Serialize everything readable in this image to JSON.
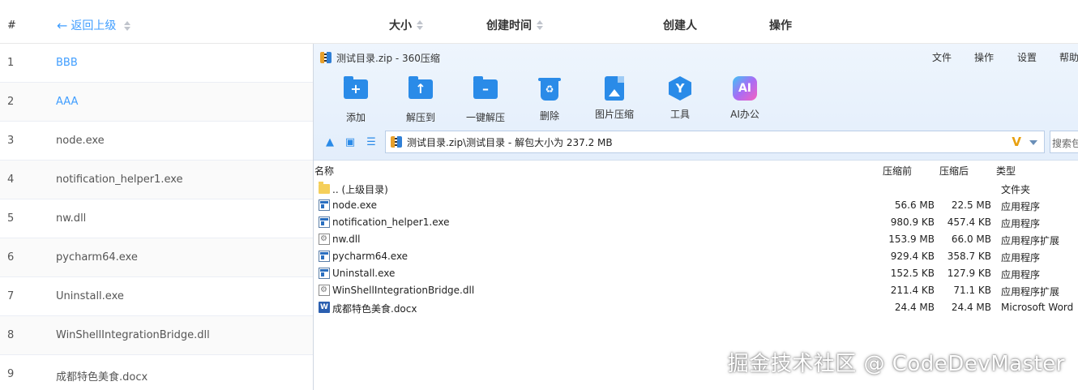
{
  "table_header": {
    "num": "#",
    "back": "返回上级",
    "size": "大小",
    "created": "创建时间",
    "creator": "创建人",
    "action": "操作"
  },
  "table_rows": [
    {
      "idx": "1",
      "name": "BBB"
    },
    {
      "idx": "2",
      "name": "AAA"
    },
    {
      "idx": "3",
      "name": "node.exe"
    },
    {
      "idx": "4",
      "name": "notification_helper1.exe"
    },
    {
      "idx": "5",
      "name": "nw.dll"
    },
    {
      "idx": "6",
      "name": "pycharm64.exe"
    },
    {
      "idx": "7",
      "name": "Uninstall.exe"
    },
    {
      "idx": "8",
      "name": "WinShellIntegrationBridge.dll"
    },
    {
      "idx": "9",
      "name": "成都特色美食.docx"
    }
  ],
  "zip_window": {
    "title": "测试目录.zip - 360压缩",
    "menu": [
      "文件",
      "操作",
      "设置",
      "帮助"
    ],
    "toolbar": [
      {
        "label": "添加",
        "icon": "add-folder-icon"
      },
      {
        "label": "解压到",
        "icon": "extract-to-icon"
      },
      {
        "label": "一键解压",
        "icon": "one-click-extract-icon"
      },
      {
        "label": "删除",
        "icon": "delete-icon"
      },
      {
        "label": "图片压缩",
        "icon": "image-compress-icon"
      },
      {
        "label": "工具",
        "icon": "tools-icon"
      },
      {
        "label": "AI办公",
        "icon": "ai-office-icon"
      }
    ],
    "ai_icon_text": "AI",
    "address": "测试目录.zip\\测试目录 - 解包大小为 237.2 MB",
    "search_placeholder": "搜索包",
    "columns": {
      "name": "名称",
      "before": "压缩前",
      "after": "压缩后",
      "type": "类型"
    },
    "files": [
      {
        "name": ".. (上级目录)",
        "before": "",
        "after": "",
        "type": "文件夹",
        "icon": "folder"
      },
      {
        "name": "node.exe",
        "before": "56.6 MB",
        "after": "22.5 MB",
        "type": "应用程序",
        "icon": "exe"
      },
      {
        "name": "notification_helper1.exe",
        "before": "980.9 KB",
        "after": "457.4 KB",
        "type": "应用程序",
        "icon": "exe"
      },
      {
        "name": "nw.dll",
        "before": "153.9 MB",
        "after": "66.0 MB",
        "type": "应用程序扩展",
        "icon": "dll"
      },
      {
        "name": "pycharm64.exe",
        "before": "929.4 KB",
        "after": "358.7 KB",
        "type": "应用程序",
        "icon": "exe"
      },
      {
        "name": "Uninstall.exe",
        "before": "152.5 KB",
        "after": "127.9 KB",
        "type": "应用程序",
        "icon": "exe"
      },
      {
        "name": "WinShellIntegrationBridge.dll",
        "before": "211.4 KB",
        "after": "71.1 KB",
        "type": "应用程序扩展",
        "icon": "dll"
      },
      {
        "name": "成都特色美食.docx",
        "before": "24.4 MB",
        "after": "24.4 MB",
        "type": "Microsoft Word",
        "icon": "doc"
      }
    ],
    "doc_icon_text": "W"
  },
  "watermark": "掘金技术社区 @ CodeDevMaster",
  "colors": {
    "link": "#409eff",
    "accent": "#2a8be8"
  }
}
